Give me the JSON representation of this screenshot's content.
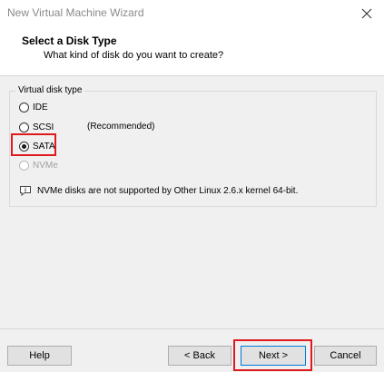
{
  "window": {
    "title": "New Virtual Machine Wizard",
    "close_icon": "close-icon"
  },
  "header": {
    "title": "Select a Disk Type",
    "subtitle": "What kind of disk do you want to create?"
  },
  "disk_type": {
    "group_label": "Virtual disk type",
    "options": [
      {
        "label": "IDE",
        "checked": false,
        "enabled": true
      },
      {
        "label": "SCSI",
        "note": "(Recommended)",
        "checked": false,
        "enabled": true
      },
      {
        "label": "SATA",
        "checked": true,
        "enabled": true
      },
      {
        "label": "NVMe",
        "checked": false,
        "enabled": false
      }
    ],
    "info_text": "NVMe disks are not supported by Other Linux 2.6.x kernel 64-bit."
  },
  "buttons": {
    "help": "Help",
    "back": "< Back",
    "next": "Next >",
    "cancel": "Cancel"
  },
  "colors": {
    "highlight": "#e0191e",
    "accent": "#0078d7"
  }
}
